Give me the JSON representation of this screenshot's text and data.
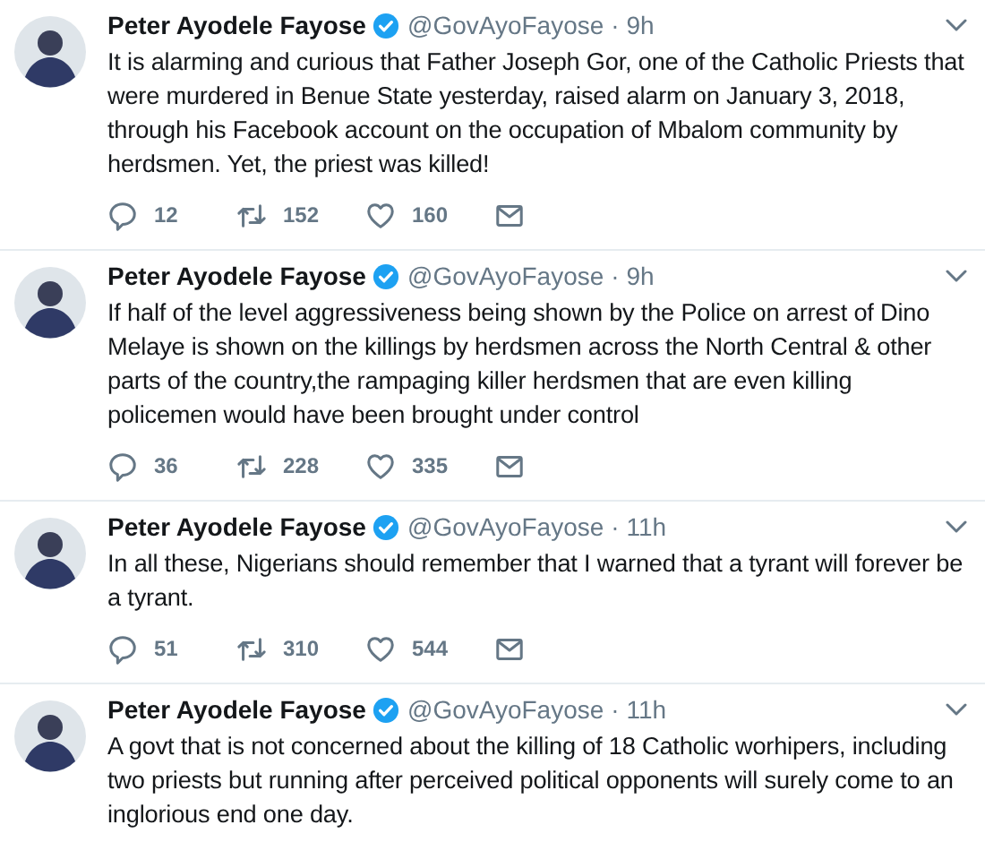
{
  "tweets": [
    {
      "name": "Peter Ayodele Fayose",
      "verified": true,
      "handle": "@GovAyoFayose",
      "time": "· 9h",
      "text": "It is alarming and curious that Father Joseph Gor, one of the Catholic Priests that were murdered in Benue State yesterday, raised alarm on January 3, 2018, through his Facebook account on the occupation of Mbalom community by herdsmen. Yet, the priest was killed!",
      "replies": "12",
      "retweets": "152",
      "likes": "160"
    },
    {
      "name": "Peter Ayodele Fayose",
      "verified": true,
      "handle": "@GovAyoFayose",
      "time": "· 9h",
      "text": "If half of the level aggressiveness being shown by the Police on arrest of Dino Melaye is shown on the killings by herdsmen across the North Central & other parts of the country,the rampaging killer herdsmen that are even killing policemen would have been brought under control",
      "replies": "36",
      "retweets": "228",
      "likes": "335"
    },
    {
      "name": "Peter Ayodele Fayose",
      "verified": true,
      "handle": "@GovAyoFayose",
      "time": "· 11h",
      "text": "In all these,  Nigerians should remember that I warned that a tyrant will forever be a tyrant.",
      "replies": "51",
      "retweets": "310",
      "likes": "544"
    },
    {
      "name": "Peter Ayodele Fayose",
      "verified": true,
      "handle": "@GovAyoFayose",
      "time": "· 11h",
      "text": "A govt that is not concerned about the killing of 18 Catholic worhipers,  including two priests but running after perceived political opponents will surely come to an inglorious end one day."
    }
  ]
}
